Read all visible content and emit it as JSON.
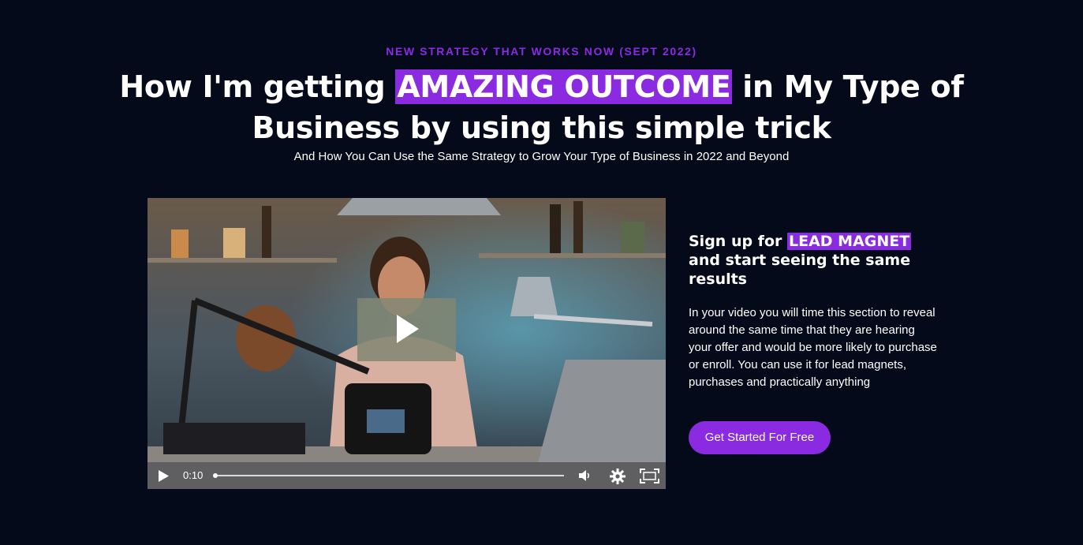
{
  "hero": {
    "eyebrow": "NEW STRATEGY THAT WORKS NOW (SEPT 2022)",
    "headline_before": "How I'm getting ",
    "headline_highlight": "AMAZING OUTCOME",
    "headline_after": " in My Type of Business by using this simple trick",
    "subheadline": "And How You Can Use the Same Strategy to Grow Your Type of Business in 2022 and Beyond"
  },
  "video": {
    "current_time": "0:10",
    "progress": 0,
    "icons": [
      "play-icon",
      "volume-icon",
      "settings-gear-icon",
      "fullscreen-icon"
    ]
  },
  "offer": {
    "title_before": "Sign up for ",
    "title_highlight": "LEAD MAGNET",
    "title_after": " and start seeing the same results",
    "body": "In your video you will time this section to reveal around the same time that they are hearing your offer and would be more likely to purchase or enroll. You can use it for lead magnets, purchases and practically anything",
    "cta_label": "Get Started For Free"
  },
  "colors": {
    "background": "#050a1a",
    "accent": "#8a2be2",
    "text": "#ffffff"
  }
}
